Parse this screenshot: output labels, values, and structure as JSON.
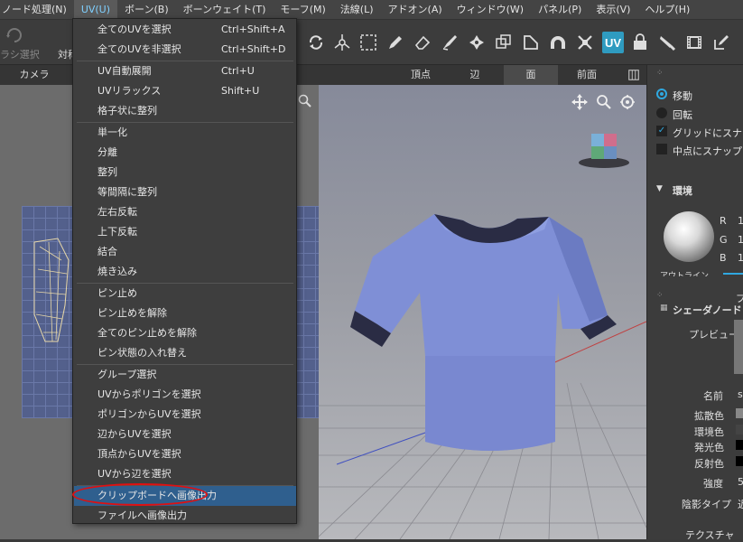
{
  "menubar": {
    "items": [
      "ノード処理(N)",
      "UV(U)",
      "ボーン(B)",
      "ボーンウェイト(T)",
      "モーフ(M)",
      "法線(L)",
      "アドオン(A)",
      "ウィンドウ(W)",
      "パネル(P)",
      "表示(V)",
      "ヘルプ(H)"
    ]
  },
  "toolbar": {
    "left_label_1": "ラシ選択",
    "left_label_2": "対称",
    "uv_button": "UV"
  },
  "tabs": {
    "camera": "カメラ",
    "vertex": "頂点",
    "edge": "辺",
    "face": "面",
    "front": "前面"
  },
  "uv_menu": {
    "items": [
      {
        "label": "全てのUVを選択",
        "shortcut": "Ctrl+Shift+A"
      },
      {
        "label": "全てのUVを非選択",
        "shortcut": "Ctrl+Shift+D"
      },
      {
        "label": "UV自動展開",
        "shortcut": "Ctrl+U"
      },
      {
        "label": "UVリラックス",
        "shortcut": "Shift+U"
      },
      {
        "label": "格子状に整列",
        "shortcut": ""
      },
      {
        "label": "単一化",
        "shortcut": ""
      },
      {
        "label": "分離",
        "shortcut": ""
      },
      {
        "label": "整列",
        "shortcut": ""
      },
      {
        "label": "等間隔に整列",
        "shortcut": ""
      },
      {
        "label": "左右反転",
        "shortcut": ""
      },
      {
        "label": "上下反転",
        "shortcut": ""
      },
      {
        "label": "結合",
        "shortcut": ""
      },
      {
        "label": "焼き込み",
        "shortcut": ""
      },
      {
        "label": "ピン止め",
        "shortcut": ""
      },
      {
        "label": "ピン止めを解除",
        "shortcut": ""
      },
      {
        "label": "全てのピン止めを解除",
        "shortcut": ""
      },
      {
        "label": "ピン状態の入れ替え",
        "shortcut": ""
      },
      {
        "label": "グループ選択",
        "shortcut": ""
      },
      {
        "label": "UVからポリゴンを選択",
        "shortcut": ""
      },
      {
        "label": "ポリゴンからUVを選択",
        "shortcut": ""
      },
      {
        "label": "辺からUVを選択",
        "shortcut": ""
      },
      {
        "label": "頂点からUVを選択",
        "shortcut": ""
      },
      {
        "label": "UVから辺を選択",
        "shortcut": ""
      },
      {
        "label": "クリップボードへ画像出力",
        "shortcut": ""
      },
      {
        "label": "ファイルへ画像出力",
        "shortcut": ""
      }
    ]
  },
  "right_panel": {
    "move": "移動",
    "rotate": "回転",
    "grid_snap": "グリッドにスナップ",
    "midpoint_snap": "中点にスナップ",
    "environment": "環境",
    "r": "R",
    "g": "G",
    "b": "B",
    "r_val": "1",
    "g_val": "1",
    "b_val": "1",
    "outline": "アウトライン",
    "shader_node": "シェーダノード",
    "shader_node_suffix": "プ",
    "preview": "プレビュー",
    "name": "名前",
    "name_val": "s",
    "diffuse": "拡散色",
    "ambient": "環境色",
    "emission": "発光色",
    "specular": "反射色",
    "strength": "強度",
    "strength_val": "5",
    "shading_type": "陰影タイプ",
    "shading_val": "近",
    "texture": "テクスチャ"
  },
  "colors": {
    "accent": "#2f9bc0",
    "menu_highlight": "#2f5f8e",
    "annotation_circle": "#e01010",
    "shirt": "#7f8fd6"
  }
}
